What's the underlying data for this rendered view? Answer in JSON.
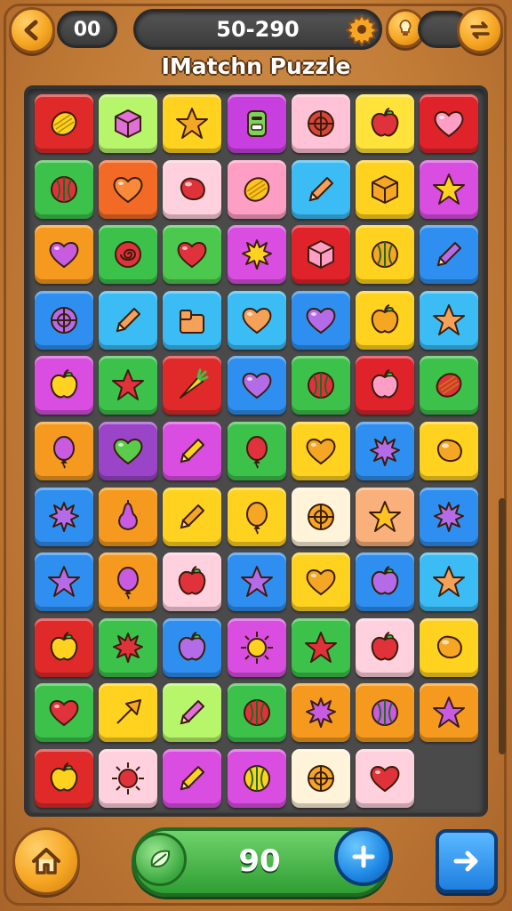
{
  "header": {
    "back_icon": "back-arrow-icon",
    "left_counter": "00",
    "score": "50-290",
    "gear_icon": "gear-icon",
    "hint_icon": "lightbulb-icon",
    "swap_icon": "swap-arrows-icon"
  },
  "title": "IMatchn Puzzle",
  "board": {
    "columns": 7,
    "rows": 11,
    "tiles": [
      [
        {
          "bg": "#e02a2a",
          "icon": "lemon"
        },
        {
          "bg": "#b7f56a",
          "icon": "cube"
        },
        {
          "bg": "#ffd21f",
          "icon": "star"
        },
        {
          "bg": "#c83fe0",
          "icon": "robot"
        },
        {
          "bg": "#ffc2d6",
          "icon": "ball"
        },
        {
          "bg": "#ffe23a",
          "icon": "apple"
        },
        {
          "bg": "#e0232b",
          "icon": "heart"
        }
      ],
      [
        {
          "bg": "#3cc24a",
          "icon": "watermelon"
        },
        {
          "bg": "#f26a26",
          "icon": "heart"
        },
        {
          "bg": "#ffd0de",
          "icon": "blob"
        },
        {
          "bg": "#ff9ec4",
          "icon": "lemon"
        },
        {
          "bg": "#3bbcf5",
          "icon": "pencil"
        },
        {
          "bg": "#ffd21f",
          "icon": "cube"
        },
        {
          "bg": "#d94ee0",
          "icon": "star"
        }
      ],
      [
        {
          "bg": "#f59a1f",
          "icon": "heart"
        },
        {
          "bg": "#3cc24a",
          "icon": "spiral"
        },
        {
          "bg": "#4cc84f",
          "icon": "heart"
        },
        {
          "bg": "#d94ee0",
          "icon": "splat"
        },
        {
          "bg": "#e0232b",
          "icon": "cube"
        },
        {
          "bg": "#ffd21f",
          "icon": "watermelon"
        },
        {
          "bg": "#2f8ff0",
          "icon": "pencil"
        }
      ],
      [
        {
          "bg": "#2f8ff0",
          "icon": "ball"
        },
        {
          "bg": "#3bbcf5",
          "icon": "pencil"
        },
        {
          "bg": "#3bbcf5",
          "icon": "gift"
        },
        {
          "bg": "#3bbcf5",
          "icon": "heart"
        },
        {
          "bg": "#2f8ff0",
          "icon": "heart"
        },
        {
          "bg": "#ffd21f",
          "icon": "apple"
        },
        {
          "bg": "#3bbcf5",
          "icon": "star"
        }
      ],
      [
        {
          "bg": "#d94ee0",
          "icon": "apple"
        },
        {
          "bg": "#3cc24a",
          "icon": "star"
        },
        {
          "bg": "#e02a2a",
          "icon": "carrot"
        },
        {
          "bg": "#2f8ff0",
          "icon": "heart"
        },
        {
          "bg": "#3cc24a",
          "icon": "watermelon"
        },
        {
          "bg": "#e0232b",
          "icon": "apple"
        },
        {
          "bg": "#3cc24a",
          "icon": "lemon"
        }
      ],
      [
        {
          "bg": "#f59a1f",
          "icon": "balloon"
        },
        {
          "bg": "#9a45c8",
          "icon": "heart"
        },
        {
          "bg": "#d94ee0",
          "icon": "pencil"
        },
        {
          "bg": "#3cc24a",
          "icon": "balloon"
        },
        {
          "bg": "#ffd21f",
          "icon": "heart"
        },
        {
          "bg": "#2f8ff0",
          "icon": "splat"
        },
        {
          "bg": "#ffd21f",
          "icon": "blob"
        }
      ],
      [
        {
          "bg": "#2f8ff0",
          "icon": "splat"
        },
        {
          "bg": "#f59a1f",
          "icon": "pear"
        },
        {
          "bg": "#ffd21f",
          "icon": "pencil"
        },
        {
          "bg": "#ffd21f",
          "icon": "balloon"
        },
        {
          "bg": "#fff4da",
          "icon": "ball"
        },
        {
          "bg": "#f9b07a",
          "icon": "star"
        },
        {
          "bg": "#2f8ff0",
          "icon": "splat"
        }
      ],
      [
        {
          "bg": "#2f8ff0",
          "icon": "star"
        },
        {
          "bg": "#f59a1f",
          "icon": "balloon"
        },
        {
          "bg": "#ffd0de",
          "icon": "apple"
        },
        {
          "bg": "#2f8ff0",
          "icon": "star"
        },
        {
          "bg": "#ffd21f",
          "icon": "heart"
        },
        {
          "bg": "#2f8ff0",
          "icon": "apple"
        },
        {
          "bg": "#3bbcf5",
          "icon": "star"
        }
      ],
      [
        {
          "bg": "#e02a2a",
          "icon": "apple"
        },
        {
          "bg": "#3cc24a",
          "icon": "splat"
        },
        {
          "bg": "#2f8ff0",
          "icon": "apple"
        },
        {
          "bg": "#d94ee0",
          "icon": "sun"
        },
        {
          "bg": "#3cc24a",
          "icon": "star"
        },
        {
          "bg": "#ffd0de",
          "icon": "apple"
        },
        {
          "bg": "#ffd21f",
          "icon": "blob"
        }
      ],
      [
        {
          "bg": "#3cc24a",
          "icon": "heart"
        },
        {
          "bg": "#ffd21f",
          "icon": "arrow"
        },
        {
          "bg": "#b7f56a",
          "icon": "pencil"
        },
        {
          "bg": "#3cc24a",
          "icon": "watermelon"
        },
        {
          "bg": "#f59a1f",
          "icon": "splat"
        },
        {
          "bg": "#f59a1f",
          "icon": "watermelon"
        },
        {
          "bg": "#f59a1f",
          "icon": "star"
        }
      ],
      [
        {
          "bg": "#e02a2a",
          "icon": "apple"
        },
        {
          "bg": "#ffd0de",
          "icon": "sun"
        },
        {
          "bg": "#d94ee0",
          "icon": "pencil"
        },
        {
          "bg": "#d94ee0",
          "icon": "watermelon"
        },
        {
          "bg": "#fff4da",
          "icon": "ball"
        },
        {
          "bg": "#ffd0de",
          "icon": "heart"
        },
        null
      ]
    ]
  },
  "footer": {
    "home_icon": "home-icon",
    "leaf_icon": "leaf-icon",
    "moves": "90",
    "plus_icon": "plus-icon",
    "next_icon": "right-arrow-icon"
  }
}
